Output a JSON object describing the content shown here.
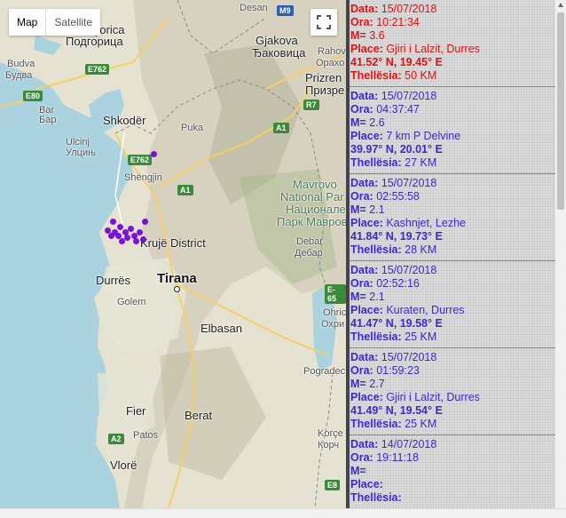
{
  "map": {
    "type_buttons": [
      "Map",
      "Satellite"
    ],
    "labels": {
      "desan": "Desan",
      "podgorica": "Podgorica",
      "podgorica_cyr": "Подгорица",
      "budva": "Budva",
      "budva_cyr": "Будва",
      "bar": "Bar",
      "bar_cyr": "Бар",
      "ulcinj": "Ulcinj",
      "ulcinj_cyr": "Улцињ",
      "shkoder": "Shkodër",
      "puka": "Puka",
      "shengjin": "Shëngjin",
      "gjakova": "Gjakova",
      "gjakova_cyr": "Ђаковица",
      "rahovec": "Rahov",
      "rahovec_cyr": "Орахо",
      "prizren": "Prizren",
      "prizren_cyr": "Призре",
      "mavrovo1": "Mavrovo",
      "mavrovo2": "National Par",
      "mavrovo3": "Национален",
      "mavrovo4": "Парк Маврово",
      "debar": "Debar",
      "debar_cyr": "Дебар",
      "kruje": "Krujë District",
      "tirana": "Tirana",
      "durres": "Durrës",
      "golem": "Golem",
      "elbasan": "Elbasan",
      "ohrid": "Ohric",
      "ohrid_cyr": "Охри",
      "pogradec": "Pogradec",
      "fier": "Fier",
      "berat": "Berat",
      "patos": "Patos",
      "vlore": "Vlorë",
      "korce": "Korçe",
      "korce_cyr": "Корч"
    },
    "roads": [
      "E762",
      "E80",
      "E762",
      "A1",
      "A1",
      "M9",
      "R7",
      "E-65",
      "A2",
      "E8"
    ],
    "quake_color": "#6a00cc"
  },
  "entries": [
    {
      "data": "15/07/2018",
      "ora": "10:21:34",
      "m": "3.6",
      "place": "Gjiri i Lalzit, Durres",
      "coords": "41.52° N, 19.45° E",
      "thellesia": "50 KM",
      "highlight": true
    },
    {
      "data": "15/07/2018",
      "ora": "04:37:47",
      "m": "2.6",
      "place": "7 km P Delvine",
      "coords": "39.97° N, 20.01° E",
      "thellesia": "27 KM",
      "highlight": false
    },
    {
      "data": "15/07/2018",
      "ora": "02:55:58",
      "m": "2.1",
      "place": "Kashnjet, Lezhe",
      "coords": "41.84° N, 19.73° E",
      "thellesia": "28 KM",
      "highlight": false
    },
    {
      "data": "15/07/2018",
      "ora": "02:52:16",
      "m": "2.1",
      "place": "Kuraten, Durres",
      "coords": "41.47° N, 19.58° E",
      "thellesia": "25 KM",
      "highlight": false
    },
    {
      "data": "15/07/2018",
      "ora": "01:59:23",
      "m": "2.7",
      "place": "Gjiri i Lalzit, Durres",
      "coords": "41.49° N, 19.54° E",
      "thellesia": "25 KM",
      "highlight": false
    },
    {
      "data": "14/07/2018",
      "ora": "19:11:18",
      "m": "",
      "place": "",
      "coords": "",
      "thellesia": "",
      "highlight": false
    }
  ],
  "field_labels": {
    "data": "Data:",
    "ora": "Ora:",
    "m": "M=",
    "place": "Place:",
    "thellesia": "Thellësia:"
  }
}
